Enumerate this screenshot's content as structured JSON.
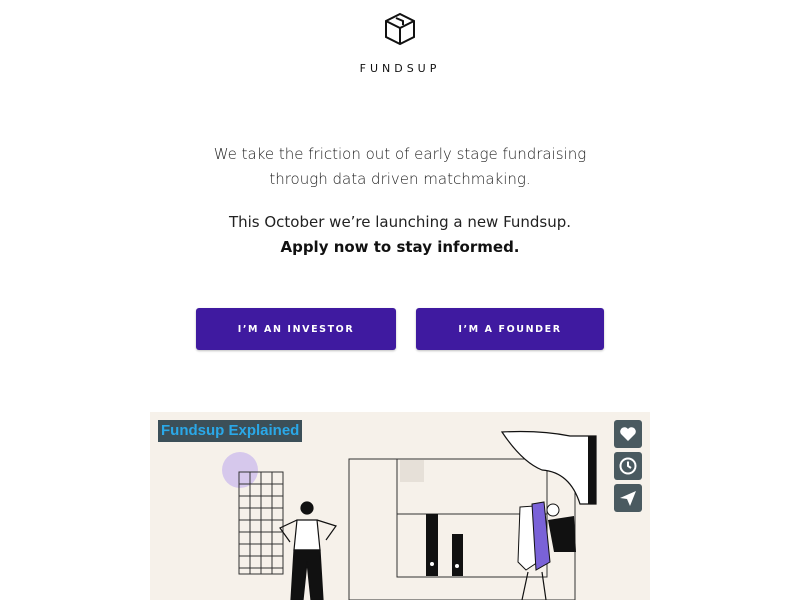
{
  "brand": {
    "name": "FUNDSUP",
    "logo_icon": "box-logo-icon"
  },
  "hero": {
    "tagline_line1": "We take the friction out of early stage fundraising",
    "tagline_line2": "through data driven matchmaking.",
    "announce_line1": "This October we’re launching a new Fundsup.",
    "announce_line2": "Apply now to stay informed."
  },
  "actions": {
    "investor_label": "I’M AN INVESTOR",
    "founder_label": "I’M A FOUNDER",
    "accent": "#3f1aa0"
  },
  "video": {
    "title": "Fundsup Explained",
    "controls": [
      "heart-icon",
      "clock-icon",
      "send-icon"
    ]
  }
}
